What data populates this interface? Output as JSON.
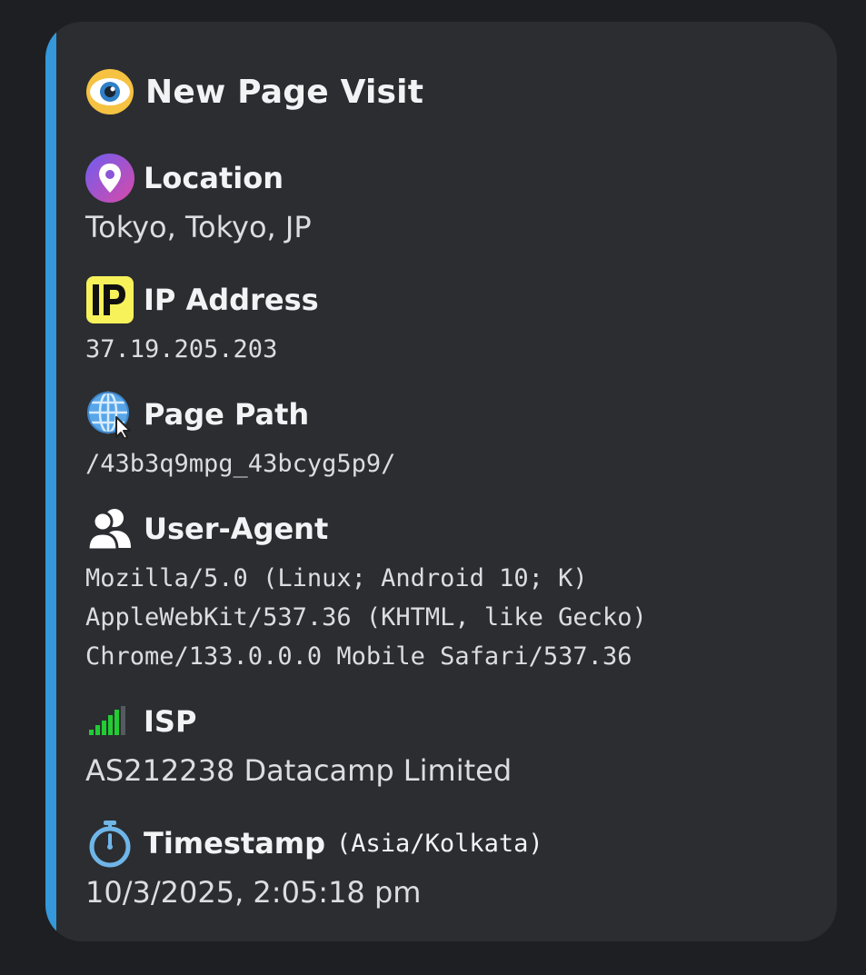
{
  "embed": {
    "accent_color": "#3498db",
    "title": {
      "icon": "eye-icon",
      "text": "New Page Visit"
    },
    "fields": {
      "location": {
        "icon": "location-pin-icon",
        "name": "Location",
        "value": "Tokyo, Tokyo, JP"
      },
      "ip": {
        "icon": "ip-icon",
        "name": "IP Address",
        "value": "37.19.205.203"
      },
      "page_path": {
        "icon": "globe-cursor-icon",
        "name": "Page Path",
        "value": "/43b3q9mpg_43bcyg5p9/"
      },
      "user_agent": {
        "icon": "users-icon",
        "name": "User-Agent",
        "lines": [
          "Mozilla/5.0 (Linux; Android 10; K)",
          "AppleWebKit/537.36 (KHTML, like Gecko)",
          "Chrome/133.0.0.0 Mobile Safari/537.36"
        ]
      },
      "isp": {
        "icon": "signal-bars-icon",
        "name": "ISP",
        "value": "AS212238 Datacamp Limited"
      },
      "timestamp": {
        "icon": "stopwatch-icon",
        "name": "Timestamp",
        "name_suffix": "(Asia/Kolkata)",
        "value": "10/3/2025, 2:05:18 pm"
      }
    }
  }
}
